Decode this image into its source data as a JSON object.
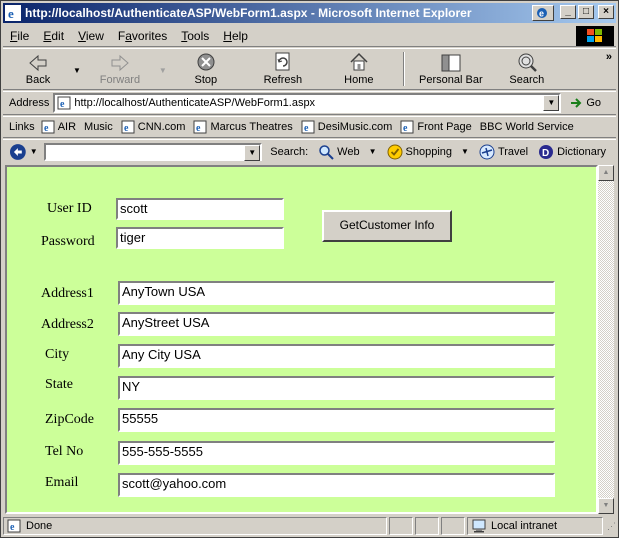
{
  "window": {
    "title": "http://localhost/AuthenticateASP/WebForm1.aspx - Microsoft Internet Explorer"
  },
  "menu": [
    {
      "label": "File",
      "accel": "F",
      "rest": "ile"
    },
    {
      "label": "Edit",
      "accel": "E",
      "rest": "dit"
    },
    {
      "label": "View",
      "accel": "V",
      "rest": "iew"
    },
    {
      "label": "Favorites",
      "accel": "a",
      "pre": "F",
      "rest": "vorites"
    },
    {
      "label": "Tools",
      "accel": "T",
      "rest": "ools"
    },
    {
      "label": "Help",
      "accel": "H",
      "rest": "elp"
    }
  ],
  "toolbar": {
    "back": "Back",
    "forward": "Forward",
    "stop": "Stop",
    "refresh": "Refresh",
    "home": "Home",
    "personal_bar": "Personal Bar",
    "search": "Search",
    "more": "»"
  },
  "address": {
    "label": "Address",
    "url": "http://localhost/AuthenticateASP/WebForm1.aspx",
    "go": "Go"
  },
  "links": {
    "label": "Links",
    "items": [
      "AIR",
      "Music",
      "CNN.com",
      "Marcus Theatres",
      "DesiMusic.com",
      "Front Page",
      "BBC World Service"
    ]
  },
  "searchbar": {
    "label": "Search:",
    "web": "Web",
    "shopping": "Shopping",
    "travel": "Travel",
    "dictionary": "Dictionary"
  },
  "form": {
    "user_id_label": "User ID",
    "user_id": "scott",
    "password_label": "Password",
    "password": "tiger",
    "button": "GetCustomer Info",
    "address1_label": "Address1",
    "address1": "AnyTown USA",
    "address2_label": "Address2",
    "address2": "AnyStreet USA",
    "city_label": "City",
    "city": "Any City USA",
    "state_label": "State",
    "state": "NY",
    "zip_label": "ZipCode",
    "zip": "55555",
    "tel_label": "Tel No",
    "tel": "555-555-5555",
    "email_label": "Email",
    "email": "scott@yahoo.com"
  },
  "status": {
    "text": "Done",
    "zone": "Local intranet"
  },
  "colors": {
    "content_bg": "#ccff99",
    "titlebar_start": "#0a246a",
    "titlebar_end": "#a6caf0",
    "chrome": "#d4d0c8"
  }
}
